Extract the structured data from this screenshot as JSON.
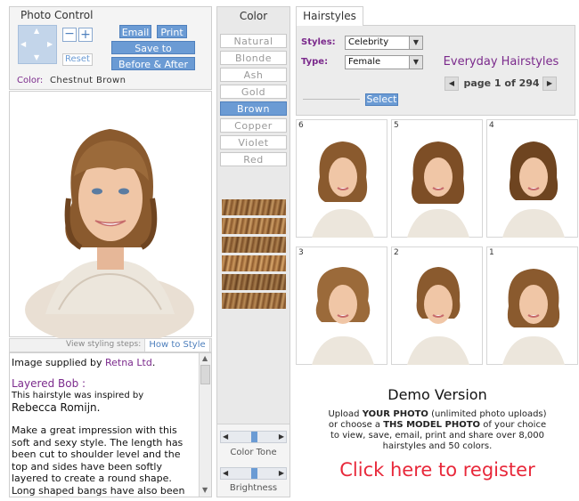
{
  "photo_control": {
    "title": "Photo Control",
    "email_label": "Email",
    "print_label": "Print",
    "reset_label": "Reset",
    "save_favorites_label": "Save to Favorites",
    "before_after_label": "Before & After",
    "color_label": "Color:",
    "color_value": "Chestnut Brown"
  },
  "styling_steps": {
    "label": "View styling steps:",
    "how_to_label": "How to Style"
  },
  "description": {
    "supplied_prefix": "Image supplied by ",
    "supplier": "Retna Ltd",
    "supplied_suffix": ".",
    "style_name": "Layered Bob :",
    "inspired_text": "This hairstyle was inspired by",
    "celebrity": "Rebecca Romijn.",
    "body": "Make a great impression with this soft and sexy style. The length has been cut to shoulder level and the top and sides have been softly layered to create a round shape. Long shaped bangs have also been cut and added over"
  },
  "color": {
    "title": "Color",
    "swatches": [
      "Natural",
      "Blonde",
      "Ash",
      "Gold",
      "Brown",
      "Copper",
      "Violet",
      "Red"
    ],
    "selected": "Brown",
    "tone_label": "Color Tone",
    "brightness_label": "Brightness"
  },
  "hairstyles": {
    "tab": "Hairstyles",
    "styles_label": "Styles:",
    "styles_value": "Celebrity",
    "type_label": "Type:",
    "type_value": "Female",
    "select_label": "Select",
    "category_title": "Everyday Hairstyles",
    "page_text": "page 1 of 294",
    "thumb_numbers": [
      "6",
      "5",
      "4",
      "3",
      "2",
      "1"
    ]
  },
  "demo": {
    "title": "Demo Version",
    "line1_a": "Upload ",
    "line1_b": "YOUR PHOTO",
    "line1_c": " (unlimited photo uploads)",
    "line2_a": "or choose a ",
    "line2_b": "THS MODEL PHOTO",
    "line2_c": " of your choice",
    "line3": "to view, save, email, print and share over 8,000",
    "line4": "hairstyles and 50 colors.",
    "register": "Click here to register"
  },
  "colors": {
    "accent": "#6b9bd4",
    "purple": "#7b2a8c",
    "register_red": "#e8283a"
  }
}
